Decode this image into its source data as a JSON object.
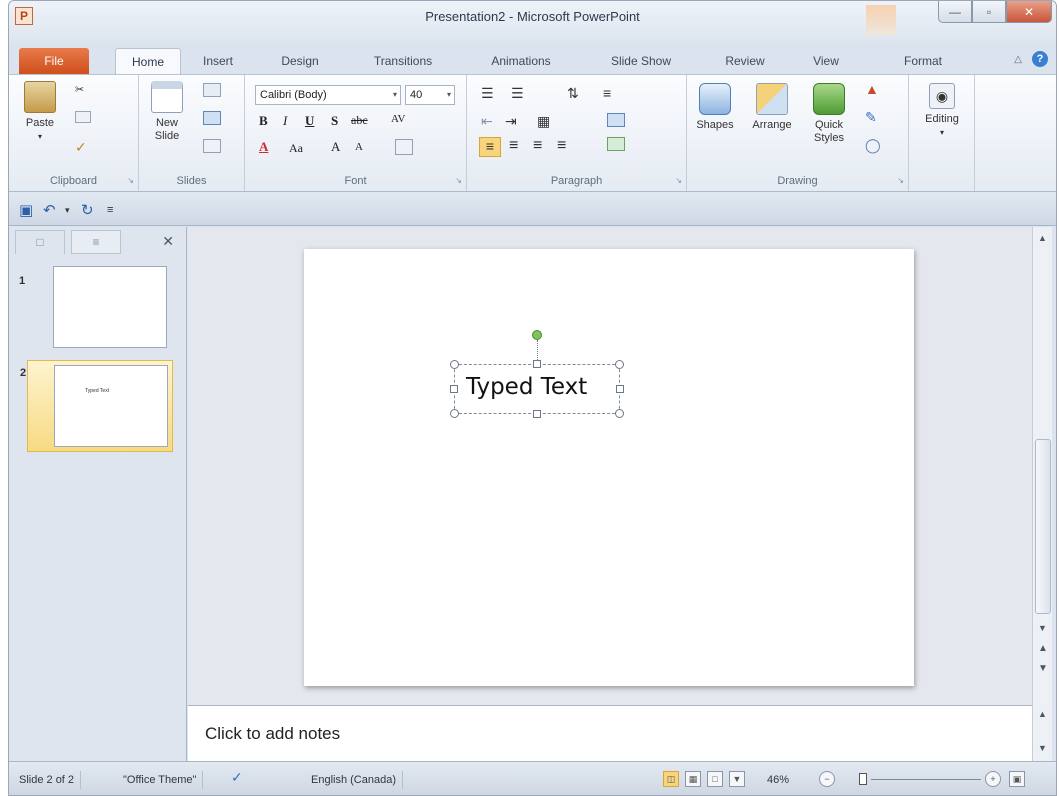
{
  "window": {
    "title": "Presentation2 - Microsoft PowerPoint",
    "app_icon_letter": "P",
    "controls": {
      "minimize": "—",
      "maximize": "▫",
      "close": "✕"
    }
  },
  "ribbon_tabs": [
    "File",
    "Home",
    "Insert",
    "Design",
    "Transitions",
    "Animations",
    "Slide Show",
    "Review",
    "View",
    "Format"
  ],
  "active_tab": "Home",
  "ribbon": {
    "clipboard": {
      "label": "Clipboard",
      "paste": "Paste"
    },
    "slides": {
      "label": "Slides",
      "new_slide_line1": "New",
      "new_slide_line2": "Slide"
    },
    "font": {
      "label": "Font",
      "font_name": "Calibri (Body)",
      "font_size": "40",
      "grow": "A",
      "shrink": "A",
      "case": "Aa"
    },
    "paragraph": {
      "label": "Paragraph"
    },
    "drawing": {
      "label": "Drawing",
      "shapes": "Shapes",
      "arrange": "Arrange",
      "quick_styles_line1": "Quick",
      "quick_styles_line2": "Styles"
    },
    "editing": {
      "label": "Editing"
    }
  },
  "slides_pane": {
    "thumbnails": [
      {
        "number": "1",
        "text": ""
      },
      {
        "number": "2",
        "text": "Typed Text"
      }
    ],
    "selected": 2
  },
  "slide": {
    "text": "Typed Text"
  },
  "notes": {
    "placeholder": "Click to add notes"
  },
  "status_bar": {
    "slide_info": "Slide 2 of 2",
    "theme": "\"Office Theme\"",
    "language": "English (Canada)",
    "zoom": "46%"
  },
  "colors": {
    "file_tab": "#cf4f1c",
    "selection_thumb": "#f8da82",
    "rotation_handle": "#7fc25a"
  }
}
